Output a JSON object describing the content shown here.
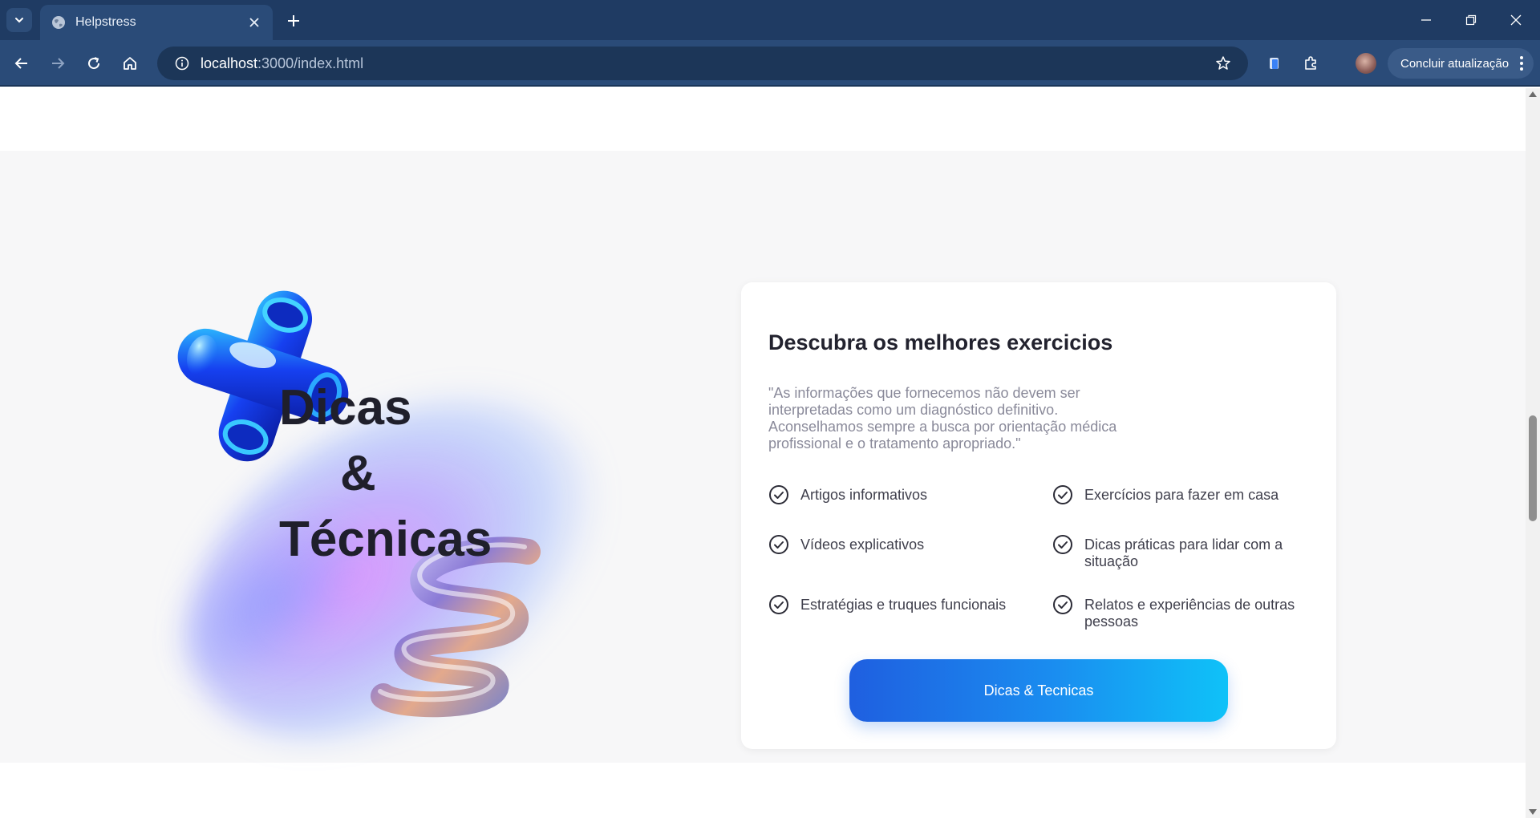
{
  "browser": {
    "tab_title": "Helpstress",
    "url_host": "localhost",
    "url_path": ":3000/index.html",
    "update_label": "Concluir atualização"
  },
  "hero": {
    "title_line1": "Dicas",
    "title_line2": "&",
    "title_line3": "Técnicas"
  },
  "card": {
    "heading": "Descubra os melhores exercicios",
    "quote": "\"As informações que fornecemos não devem ser interpretadas como um diagnóstico definitivo. Aconselhamos sempre a busca por orientação médica profissional e o tratamento apropriado.\"",
    "features": [
      "Artigos informativos",
      "Exercícios para fazer em casa",
      "Vídeos explicativos",
      "Dicas práticas para lidar com a situação",
      "Estratégias e truques funcionais",
      "Relatos e experiências de outras pessoas"
    ],
    "cta_label": "Dicas & Tecnicas"
  },
  "colors": {
    "chrome_bg": "#1f3b63",
    "accent_start": "#1f5fe0",
    "accent_end": "#0fc2f8",
    "section_bg": "#f7f7f8"
  }
}
